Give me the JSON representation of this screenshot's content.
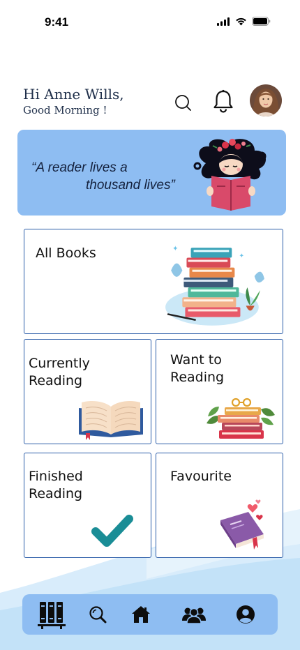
{
  "status_bar": {
    "time": "9:41",
    "icons": [
      "signal-icon",
      "wifi-icon",
      "battery-icon"
    ]
  },
  "header": {
    "greeting_name": "Hi Anne Wills,",
    "greeting_sub": "Good Morning !",
    "icons": [
      "search-icon",
      "bell-icon"
    ],
    "avatar": "user-avatar"
  },
  "quote": {
    "line1": "“A reader lives a",
    "line2": "thousand lives”",
    "illustration": "girl-reading-book-illustration"
  },
  "cards": {
    "all_books": {
      "title": "All Books",
      "illustration": "book-stack-illustration"
    },
    "currently_reading": {
      "title": "Currently\nReading",
      "illustration": "open-book-illustration"
    },
    "want_to_read": {
      "title": "Want to\nReading",
      "illustration": "books-with-glasses-illustration"
    },
    "finished_reading": {
      "title": "Finished\nReading",
      "illustration": "checkmark-icon"
    },
    "favourite": {
      "title": "Favourite",
      "illustration": "book-with-hearts-illustration"
    }
  },
  "bottom_nav": {
    "items": [
      "library-icon",
      "search-icon",
      "home-icon",
      "community-icon",
      "profile-icon"
    ]
  },
  "colors": {
    "accent_blue": "#8ebdf2",
    "card_border": "#2a5ca8",
    "check_teal": "#1a8d96",
    "greeting_text": "#1f2f4a"
  }
}
